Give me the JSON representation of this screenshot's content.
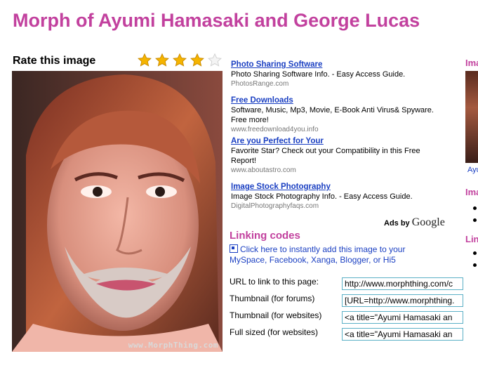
{
  "page": {
    "title": "Morph of Ayumi Hamasaki and George Lucas"
  },
  "rating": {
    "label": "Rate this image",
    "value": 4,
    "max": 5,
    "star_color": "#f5b400"
  },
  "photo": {
    "watermark": "www.MorphThing.com",
    "alt": "Morph of Ayumi Hamasaki and George Lucas"
  },
  "ads": {
    "items": [
      {
        "title": "Photo Sharing Software",
        "desc": "Photo Sharing Software Info. - Easy Access Guide.",
        "url": "PhotosRange.com"
      },
      {
        "title": "Free Downloads",
        "desc": "Software, Music, Mp3, Movie, E-Book Anti Virus& Spyware. Free more!",
        "url": "www.freedownload4you.info"
      },
      {
        "title": "Are you Perfect for Your",
        "desc": "Favorite Star? Check out your Compatibility in this Free Report!",
        "url": "www.aboutastro.com"
      },
      {
        "title": "Image Stock Photography",
        "desc": "Image Stock Photography Info. - Easy Access Guide.",
        "url": "DigitalPhotographyfaqs.com"
      }
    ],
    "attribution_prefix": "Ads by",
    "attribution_brand": "Google"
  },
  "linking": {
    "title": "Linking codes",
    "add_link": "Click here to instantly add this image to your MySpace, Facebook, Xanga, Blogger, or Hi5",
    "rows": [
      {
        "label": "URL to link to this page:",
        "value": "http://www.morphthing.com/c"
      },
      {
        "label": "Thumbnail (for forums)",
        "value": "[URL=http://www.morphthing."
      },
      {
        "label": "Thumbnail (for websites)",
        "value": "<a title=\"Ayumi Hamasaki an"
      },
      {
        "label": "Full sized (for websites)",
        "value": "<a title=\"Ayumi Hamasaki an"
      }
    ]
  },
  "right_column": {
    "heading1": "Ima",
    "thumb_caption": "Ayu",
    "heading2": "Ima",
    "heading3": "Lin"
  },
  "colors": {
    "title": "#c2419e",
    "link": "#1a3fc2",
    "input_border": "#5bb0c6"
  }
}
